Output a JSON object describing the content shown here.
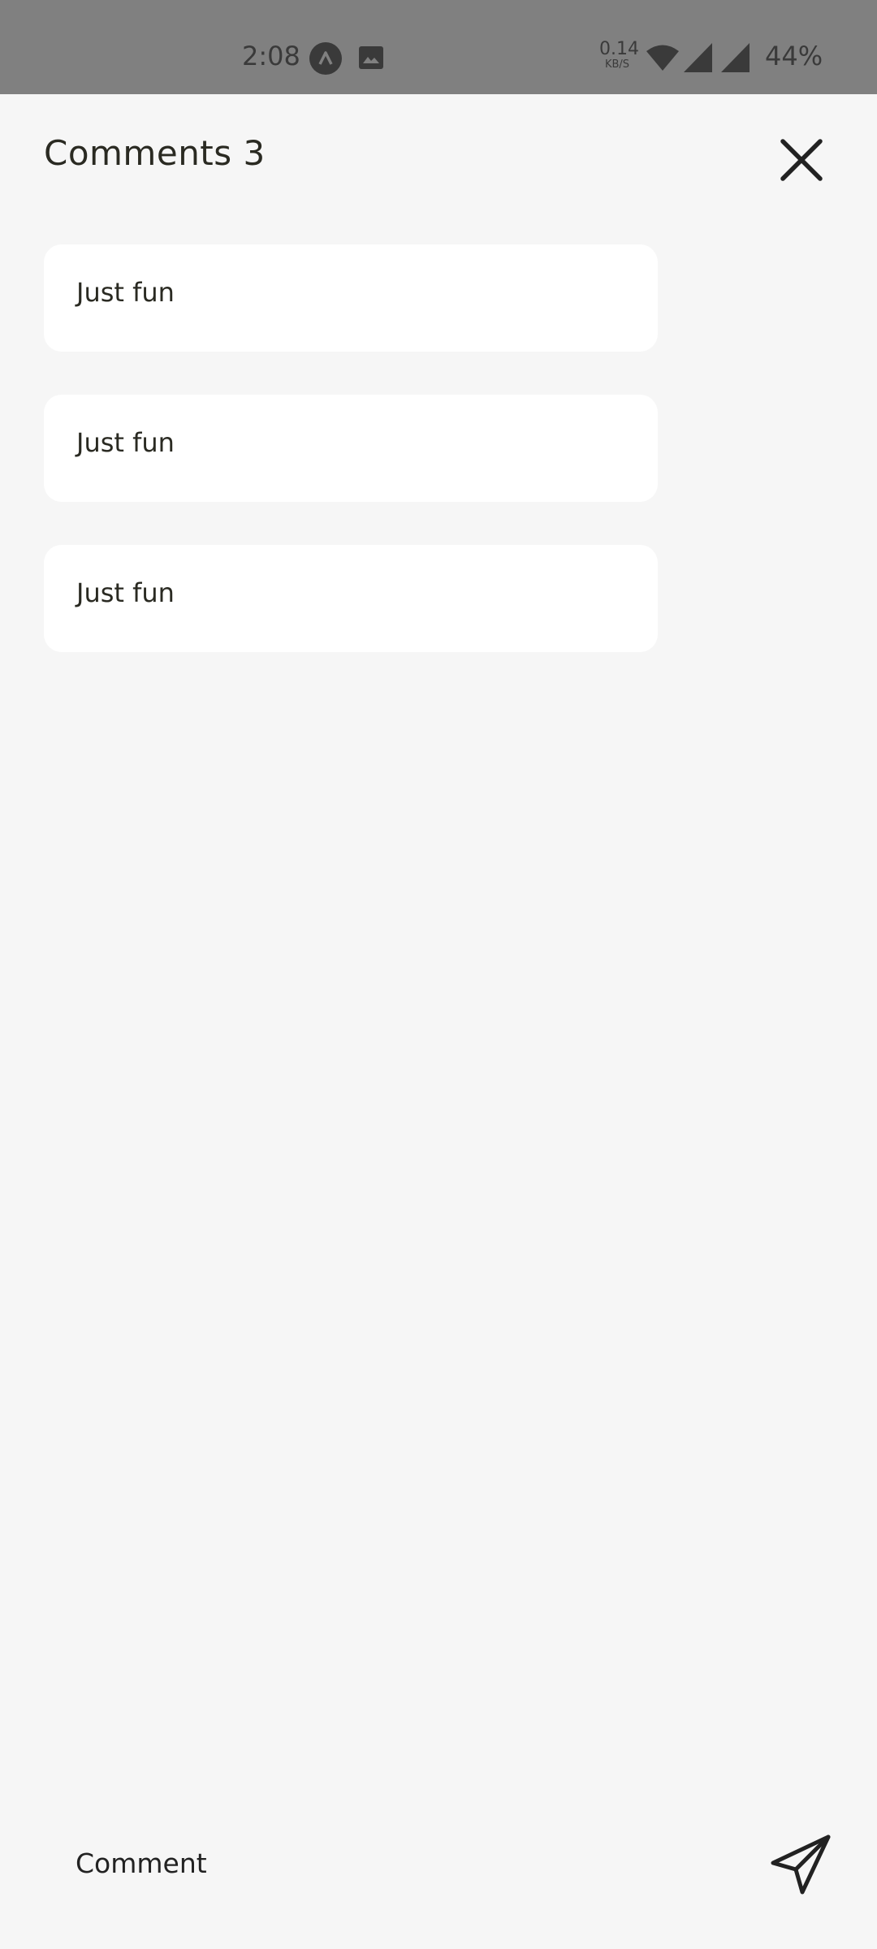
{
  "status_bar": {
    "time": "2:08",
    "net_speed_value": "0.14",
    "net_speed_unit": "KB/S",
    "battery": "44%",
    "icons": [
      "app-notification-icon",
      "gallery-icon",
      "wifi-icon",
      "signal-icon",
      "signal-icon"
    ]
  },
  "header": {
    "title": "Comments 3",
    "close_icon": "close-icon"
  },
  "comments": [
    {
      "text": "Just fun"
    },
    {
      "text": "Just fun"
    },
    {
      "text": "Just fun"
    }
  ],
  "composer": {
    "placeholder": "Comment",
    "send_icon": "send-icon"
  },
  "colors": {
    "background": "#f6f6f6",
    "status_bar": "#808080",
    "card": "#ffffff",
    "text": "#222222"
  }
}
